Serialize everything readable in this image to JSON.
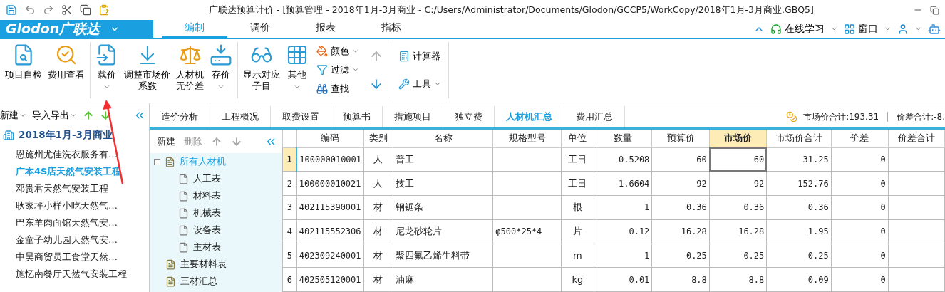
{
  "window": {
    "title": "广联达预算计价 - [预算管理 - 2018年1月-3月商业 - C:/Users/Administrator/Documents/Glodon/GCCP5/WorkCopy/2018年1月-3月商业.GBQ5]"
  },
  "menu_bar": {
    "logo": "Glodon广联达",
    "tabs": [
      {
        "label": "编制",
        "selected": true
      },
      {
        "label": "调价",
        "selected": false
      },
      {
        "label": "报表",
        "selected": false
      },
      {
        "label": "指标",
        "selected": false
      }
    ],
    "right_items": [
      {
        "label": "在线学习",
        "kind": "learn"
      },
      {
        "label": "窗口",
        "kind": "window"
      }
    ]
  },
  "ribbon": {
    "groups": [
      {
        "buttons": [
          {
            "label": "项目自检",
            "kind": "check"
          },
          {
            "label": "费用查看",
            "kind": "fees"
          }
        ]
      },
      {
        "buttons": [
          {
            "label": "载价",
            "kind": "load",
            "dropdown": true
          },
          {
            "label": "调整市场价系数",
            "kind": "adjust"
          },
          {
            "label": "人材机无价差",
            "kind": "scale"
          },
          {
            "label": "存价",
            "kind": "save",
            "dropdown": true
          }
        ]
      },
      {
        "buttons": [
          {
            "label": "显示对应子目",
            "kind": "show"
          },
          {
            "label": "其他",
            "kind": "grid",
            "dropdown": true
          }
        ],
        "small": [
          {
            "label": "颜色",
            "kind": "color",
            "dropdown": true
          },
          {
            "label": "过滤",
            "kind": "filter",
            "dropdown": true
          },
          {
            "label": "查找",
            "kind": "find",
            "dropdown": false
          }
        ],
        "arrows": true
      },
      {
        "small": [
          {
            "label": "计算器",
            "kind": "calc",
            "dropdown": false
          },
          {
            "label": "工具",
            "kind": "tools",
            "dropdown": true
          }
        ]
      }
    ]
  },
  "sidebar": {
    "toolbar": [
      {
        "label": "新建",
        "dropdown": true
      },
      {
        "label": "导入导出",
        "dropdown": true
      }
    ],
    "project": {
      "label": "2018年1月-3月商业",
      "children": [
        {
          "label": "恩施州尤佳洗衣服务有…",
          "selected": false
        },
        {
          "label": "广本4S店天然气安装工程",
          "selected": true
        },
        {
          "label": "邓贵君天然气安装工程",
          "selected": false
        },
        {
          "label": "耿家坪小样小吃天然气…",
          "selected": false
        },
        {
          "label": "巴东羊肉面馆天然气安…",
          "selected": false
        },
        {
          "label": "金童子幼儿园天然气安…",
          "selected": false
        },
        {
          "label": "中昊商贸员工食堂天然…",
          "selected": false
        },
        {
          "label": "施忆南餐厅天然气安装工程",
          "selected": false
        }
      ]
    }
  },
  "content_tabs": [
    {
      "label": "造价分析",
      "selected": false
    },
    {
      "label": "工程概况",
      "selected": false
    },
    {
      "label": "取费设置",
      "selected": false
    },
    {
      "label": "预算书",
      "selected": false
    },
    {
      "label": "措施项目",
      "selected": false
    },
    {
      "label": "独立费",
      "selected": false
    },
    {
      "label": "人材机汇总",
      "selected": true
    },
    {
      "label": "费用汇总",
      "selected": false
    }
  ],
  "summary": [
    "市场价合计:193.31",
    "价差合计:-8."
  ],
  "material_tree": {
    "toolbar": [
      {
        "label": "新建",
        "disabled": false
      },
      {
        "label": "删除",
        "disabled": true
      }
    ],
    "items": [
      {
        "label": "所有人材机",
        "selected": true,
        "expanded": true,
        "children": [
          {
            "label": "人工表",
            "selected": false
          },
          {
            "label": "材料表",
            "selected": false
          },
          {
            "label": "机械表",
            "selected": false
          },
          {
            "label": "设备表",
            "selected": false
          },
          {
            "label": "主材表",
            "selected": false
          }
        ]
      },
      {
        "label": "主要材料表",
        "selected": false
      },
      {
        "label": "三材汇总",
        "selected": false
      }
    ]
  },
  "table": {
    "columns": [
      {
        "label": "编码",
        "selected": false
      },
      {
        "label": "类别",
        "selected": false
      },
      {
        "label": "名称",
        "selected": false
      },
      {
        "label": "规格型号",
        "selected": false
      },
      {
        "label": "单位",
        "selected": false
      },
      {
        "label": "数量",
        "selected": false
      },
      {
        "label": "预算价",
        "selected": false
      },
      {
        "label": "市场价",
        "selected": true
      },
      {
        "label": "市场价合计",
        "selected": false
      },
      {
        "label": "价差",
        "selected": false
      },
      {
        "label": "价差合计",
        "selected": false
      }
    ],
    "rows": [
      {
        "number": "1",
        "selected": true,
        "cells": [
          "100000010001",
          "人",
          "普工",
          "",
          "工日",
          "0.5208",
          "60",
          "60",
          "31.25",
          "0",
          ""
        ]
      },
      {
        "number": "2",
        "selected": false,
        "cells": [
          "100000010021",
          "人",
          "技工",
          "",
          "工日",
          "1.6604",
          "92",
          "92",
          "152.76",
          "0",
          ""
        ]
      },
      {
        "number": "3",
        "selected": false,
        "cells": [
          "402115390001",
          "材",
          "钢锯条",
          "",
          "根",
          "1",
          "0.36",
          "0.36",
          "0.36",
          "0",
          ""
        ]
      },
      {
        "number": "4",
        "selected": false,
        "cells": [
          "402115552306",
          "材",
          "尼龙砂轮片",
          "φ500*25*4",
          "片",
          "0.12",
          "16.28",
          "16.28",
          "1.95",
          "0",
          ""
        ]
      },
      {
        "number": "5",
        "selected": false,
        "cells": [
          "402309240001",
          "材",
          "聚四氟乙烯生料带",
          "",
          "m",
          "1",
          "0.25",
          "0.25",
          "0.25",
          "0",
          ""
        ]
      },
      {
        "number": "6",
        "selected": false,
        "cells": [
          "402505120001",
          "材",
          "油麻",
          "",
          "kg",
          "0.01",
          "8.8",
          "8.8",
          "0.09",
          "0",
          ""
        ]
      }
    ]
  }
}
